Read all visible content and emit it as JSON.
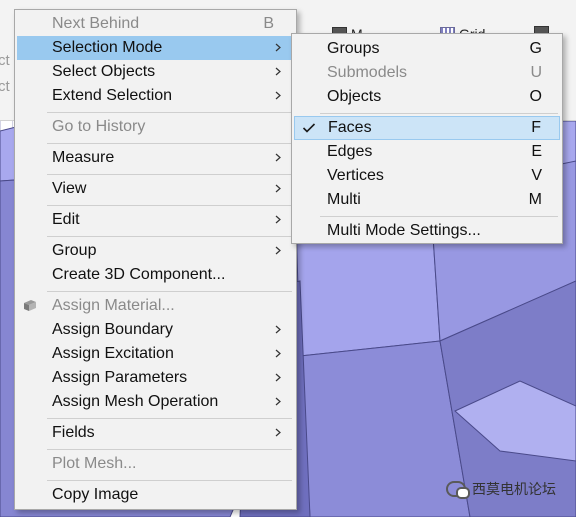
{
  "toolbar": {
    "buttons": [
      {
        "label": "M",
        "icon": "model-icon"
      },
      {
        "label": "Grid",
        "icon": "grid-icon"
      }
    ],
    "side_labels": [
      "ct",
      "ct"
    ]
  },
  "watermark": {
    "text": "西莫电机论坛",
    "icon": "wechat-icon"
  },
  "context_menu": {
    "items": [
      {
        "label": "Next Behind",
        "shortcut": "B",
        "disabled": true
      },
      {
        "label": "Selection Mode",
        "submenu": true,
        "highlighted": true
      },
      {
        "label": "Select Objects",
        "submenu": true
      },
      {
        "label": "Extend Selection",
        "submenu": true
      },
      {
        "label": "Go to History",
        "disabled": true
      },
      {
        "label": "Measure",
        "submenu": true
      },
      {
        "label": "View",
        "submenu": true
      },
      {
        "label": "Edit",
        "submenu": true
      },
      {
        "label": "Group",
        "submenu": true
      },
      {
        "label": "Create 3D Component..."
      },
      {
        "label": "Assign Material...",
        "disabled": true,
        "icon": "material-icon"
      },
      {
        "label": "Assign Boundary",
        "submenu": true
      },
      {
        "label": "Assign Excitation",
        "submenu": true
      },
      {
        "label": "Assign Parameters",
        "submenu": true
      },
      {
        "label": "Assign Mesh Operation",
        "submenu": true
      },
      {
        "label": "Fields",
        "submenu": true
      },
      {
        "label": "Plot Mesh...",
        "disabled": true
      },
      {
        "label": "Copy Image"
      }
    ]
  },
  "selection_submenu": {
    "items": [
      {
        "label": "Groups",
        "shortcut": "G"
      },
      {
        "label": "Submodels",
        "shortcut": "U",
        "disabled": true
      },
      {
        "label": "Objects",
        "shortcut": "O"
      },
      {
        "label": "Faces",
        "shortcut": "F",
        "checked": true
      },
      {
        "label": "Edges",
        "shortcut": "E"
      },
      {
        "label": "Vertices",
        "shortcut": "V"
      },
      {
        "label": "Multi",
        "shortcut": "M"
      },
      {
        "label": "Multi Mode Settings..."
      }
    ]
  },
  "colors": {
    "menu_bg": "#f2f2f2",
    "highlight": "#99c9ef",
    "check_highlight": "#cce4f7",
    "model_face": "#9d9de8",
    "model_dark": "#7474c4",
    "model_edge": "#4a4a8a"
  }
}
